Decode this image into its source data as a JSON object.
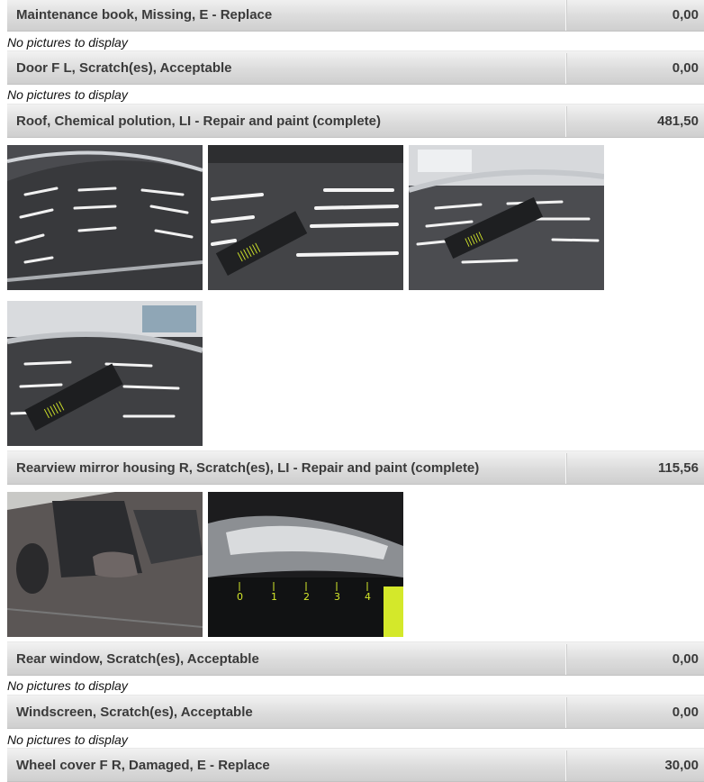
{
  "items": [
    {
      "label": "Maintenance book, Missing, E - Replace",
      "value": "0,00",
      "note": "No pictures to display"
    },
    {
      "label": "Door F L, Scratch(es), Acceptable",
      "value": "0,00",
      "note": "No pictures to display"
    },
    {
      "label": "Roof, Chemical polution, LI - Repair and paint (complete)",
      "value": "481,50"
    },
    {
      "label": "Rearview mirror housing R, Scratch(es), LI - Repair and paint (complete)",
      "value": "115,56"
    },
    {
      "label": "Rear window, Scratch(es), Acceptable",
      "value": "0,00",
      "note": "No pictures to display"
    },
    {
      "label": "Windscreen, Scratch(es), Acceptable",
      "value": "0,00",
      "note": "No pictures to display"
    },
    {
      "label": "Wheel cover F R, Damaged, E - Replace",
      "value": "30,00"
    }
  ],
  "photos": {
    "roof": [
      "roof-photo-1",
      "roof-photo-2",
      "roof-photo-3",
      "roof-photo-4"
    ],
    "mirror": [
      "mirror-photo-1",
      "mirror-photo-2"
    ]
  }
}
